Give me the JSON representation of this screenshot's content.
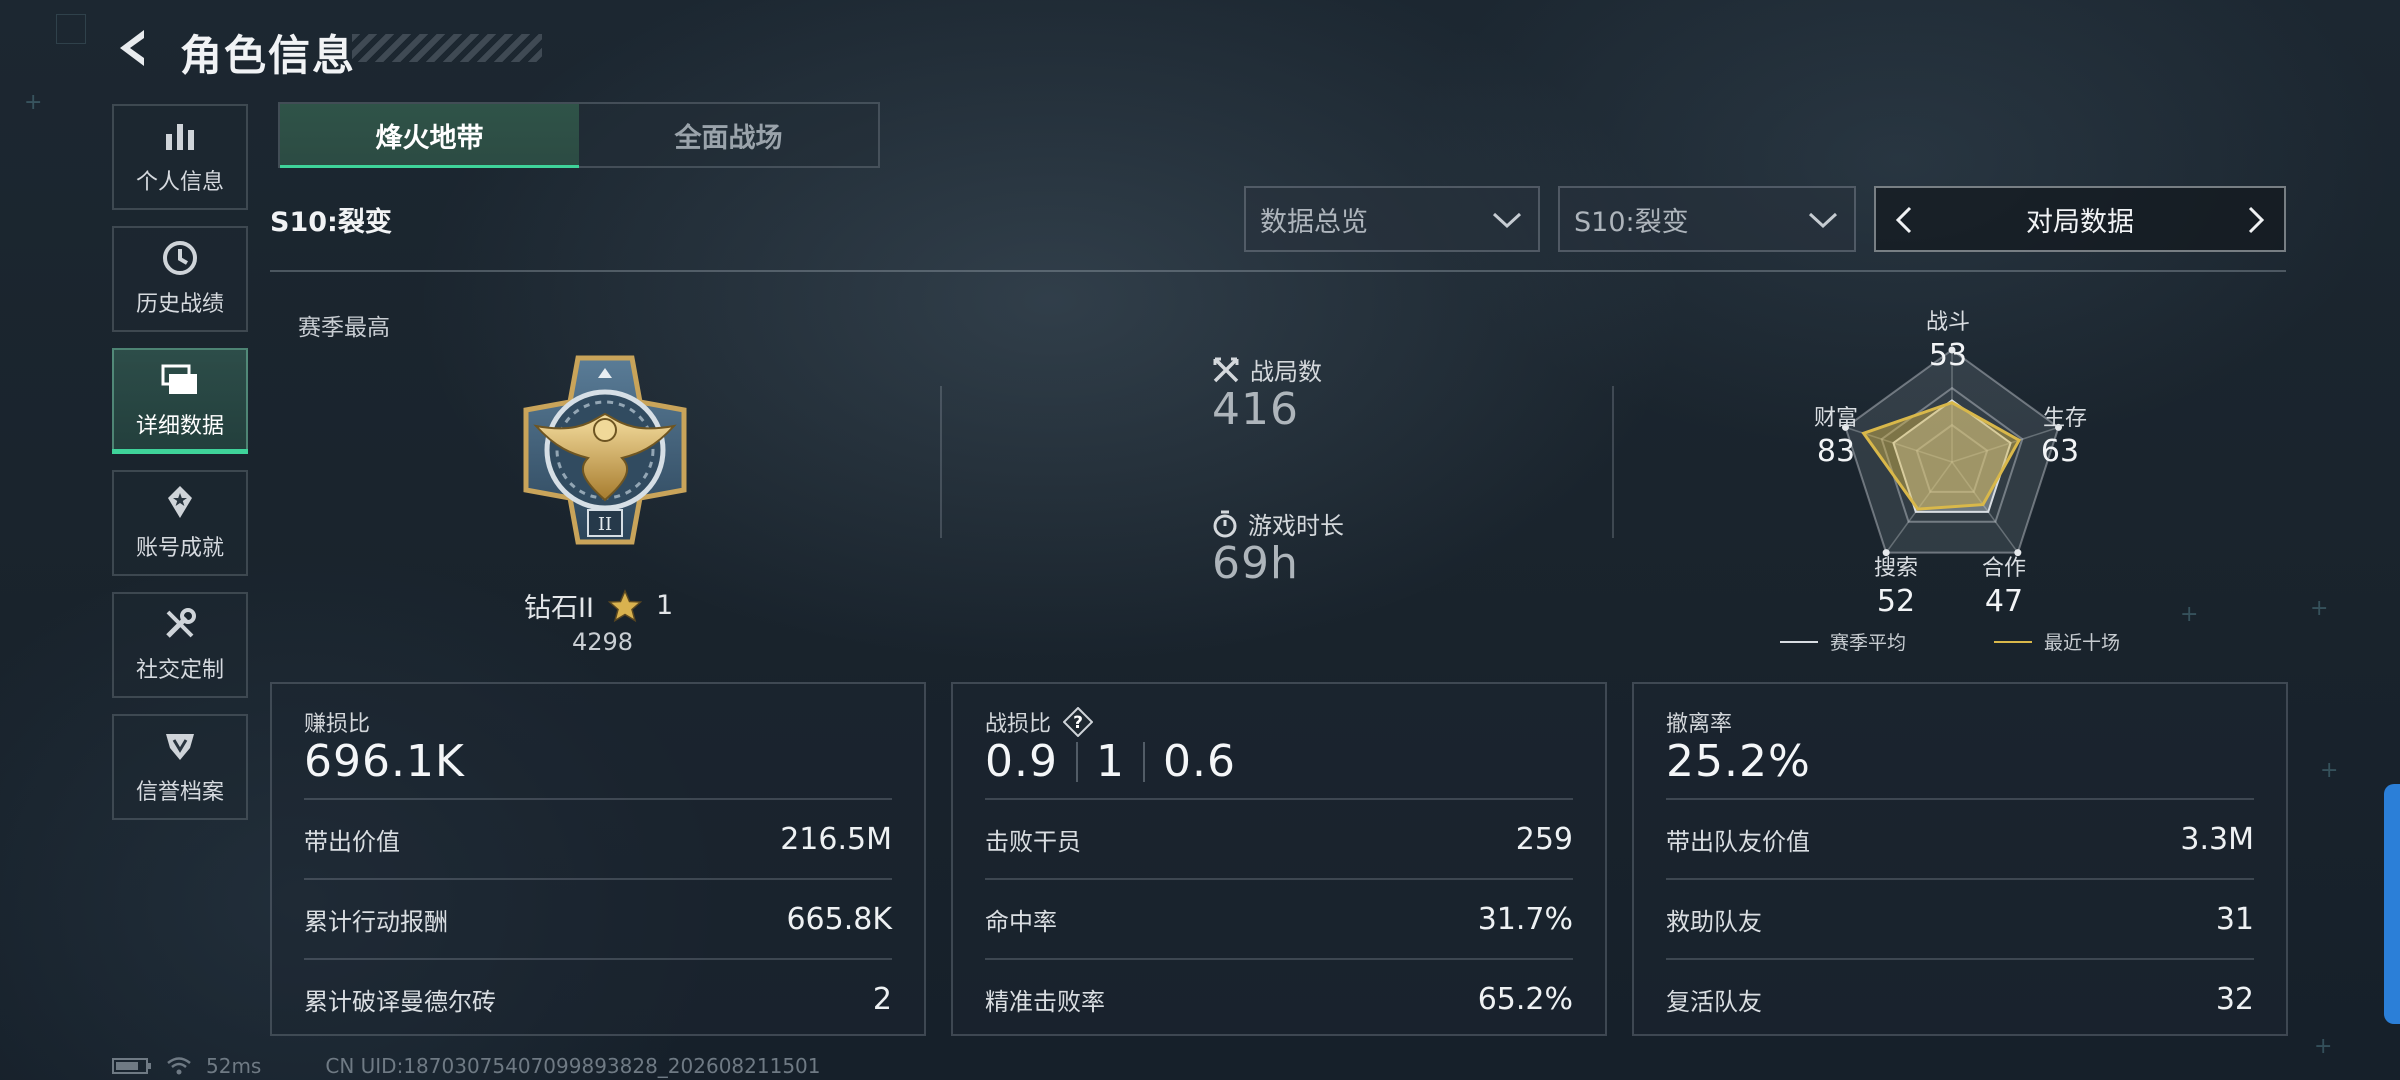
{
  "header": {
    "title": "角色信息"
  },
  "sidebar": {
    "items": [
      {
        "label": "个人信息",
        "icon": "bar-chart-icon"
      },
      {
        "label": "历史战绩",
        "icon": "history-clock-icon"
      },
      {
        "label": "详细数据",
        "icon": "folder-icon",
        "active": true
      },
      {
        "label": "账号成就",
        "icon": "achievement-icon"
      },
      {
        "label": "社交定制",
        "icon": "wrench-icon"
      },
      {
        "label": "信誉档案",
        "icon": "shield-icon"
      }
    ]
  },
  "tabs": [
    {
      "label": "烽火地带",
      "active": true
    },
    {
      "label": "全面战场",
      "active": false
    }
  ],
  "season": {
    "name": "S10:裂变"
  },
  "filters": {
    "overview": "数据总览",
    "season": "S10:裂变",
    "switcher": "对局数据"
  },
  "season_best": {
    "label": "赛季最高",
    "rank": "钻石II",
    "stars": "1",
    "score": "4298"
  },
  "middle": {
    "matches_label": "战局数",
    "matches_value": "416",
    "playtime_label": "游戏时长",
    "playtime_value": "69h"
  },
  "radar": {
    "axes": [
      {
        "label": "战斗",
        "value": "53"
      },
      {
        "label": "生存",
        "value": "63"
      },
      {
        "label": "合作",
        "value": "47"
      },
      {
        "label": "搜索",
        "value": "52"
      },
      {
        "label": "财富",
        "value": "83"
      }
    ],
    "legend_avg": "赛季平均",
    "legend_recent": "最近十场",
    "recent_color": "#d9b84a",
    "avg_color": "#d8dde2"
  },
  "cards": {
    "profit": {
      "title": "赚损比",
      "value": "696.1K",
      "rows": [
        {
          "label": "带出价值",
          "value": "216.5M"
        },
        {
          "label": "累计行动报酬",
          "value": "665.8K"
        },
        {
          "label": "累计破译曼德尔砖",
          "value": "2"
        }
      ]
    },
    "kd": {
      "title": "战损比",
      "v1": "0.9",
      "v2": "1",
      "v3": "0.6",
      "rows": [
        {
          "label": "击败干员",
          "value": "259"
        },
        {
          "label": "命中率",
          "value": "31.7%"
        },
        {
          "label": "精准击败率",
          "value": "65.2%"
        }
      ]
    },
    "extract": {
      "title": "撤离率",
      "value": "25.2%",
      "rows": [
        {
          "label": "带出队友价值",
          "value": "3.3M"
        },
        {
          "label": "救助队友",
          "value": "31"
        },
        {
          "label": "复活队友",
          "value": "32"
        }
      ]
    }
  },
  "footer": {
    "ping": "52ms",
    "uid": "CN UID:18703075407099893828_202608211501"
  },
  "colors": {
    "accent": "#3fd39a",
    "background": "#1a242d"
  }
}
